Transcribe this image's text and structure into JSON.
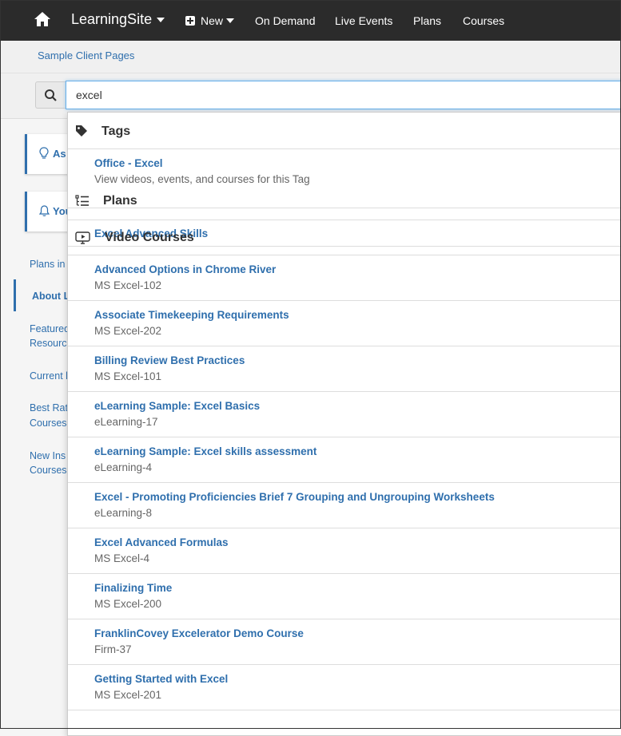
{
  "nav": {
    "brand": "LearningSite",
    "new_label": "New",
    "on_demand": "On Demand",
    "live_events": "Live Events",
    "plans": "Plans",
    "courses": "Courses"
  },
  "breadcrumb": {
    "label": "Sample Client Pages"
  },
  "search": {
    "value": "excel"
  },
  "background": {
    "card1": "As",
    "card2": "You",
    "links": [
      "Plans in",
      "About L",
      "Featured",
      "Resourc",
      "Current l",
      "Best Rat",
      "Courses",
      "New Ins",
      "Courses"
    ]
  },
  "dropdown": {
    "tags": {
      "heading": "Tags",
      "items": [
        {
          "title": "Office - Excel",
          "sub": "View videos, events, and courses for this Tag"
        }
      ]
    },
    "plans": {
      "heading": "Plans",
      "items": [
        {
          "title": "Excel Advanced Skills"
        }
      ]
    },
    "videos": {
      "heading": "Video Courses",
      "items": [
        {
          "title": "Advanced Options in Chrome River",
          "sub": "MS Excel-102"
        },
        {
          "title": "Associate Timekeeping Requirements",
          "sub": "MS Excel-202"
        },
        {
          "title": "Billing Review Best Practices",
          "sub": "MS Excel-101"
        },
        {
          "title": "eLearning Sample: Excel Basics",
          "sub": "eLearning-17"
        },
        {
          "title": "eLearning Sample: Excel skills assessment",
          "sub": "eLearning-4"
        },
        {
          "title": "Excel - Promoting Proficiencies Brief 7 Grouping and Ungrouping Worksheets",
          "sub": "eLearning-8"
        },
        {
          "title": "Excel Advanced Formulas",
          "sub": "MS Excel-4"
        },
        {
          "title": "Finalizing Time",
          "sub": "MS Excel-200"
        },
        {
          "title": "FranklinCovey Excelerator Demo Course",
          "sub": "Firm-37"
        },
        {
          "title": "Getting Started with Excel",
          "sub": "MS Excel-201"
        }
      ]
    }
  }
}
